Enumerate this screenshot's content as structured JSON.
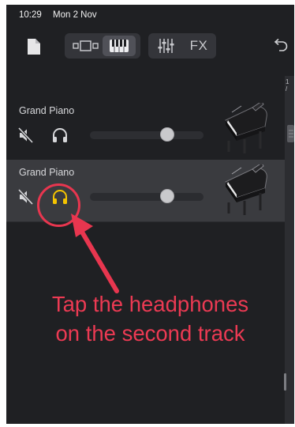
{
  "status_bar": {
    "time": "10:29",
    "date": "Mon 2 Nov"
  },
  "toolbar": {
    "fx_label": "FX"
  },
  "timeline": {
    "strip_label_line1": "1",
    "strip_label_line2": "/"
  },
  "tracks": [
    {
      "name": "Grand Piano",
      "selected": false,
      "muted": false,
      "headphones_active": false,
      "volume_fraction": 0.68
    },
    {
      "name": "Grand Piano",
      "selected": true,
      "muted": false,
      "headphones_active": true,
      "volume_fraction": 0.68
    }
  ],
  "annotation": {
    "line1": "Tap the headphones",
    "line2": "on the second track"
  },
  "colors": {
    "background": "#1f2023",
    "selected_track": "#3a3b3f",
    "headphones_active": "#f5c400",
    "icon": "#d6d7da",
    "annotation": "#ec3a53"
  }
}
